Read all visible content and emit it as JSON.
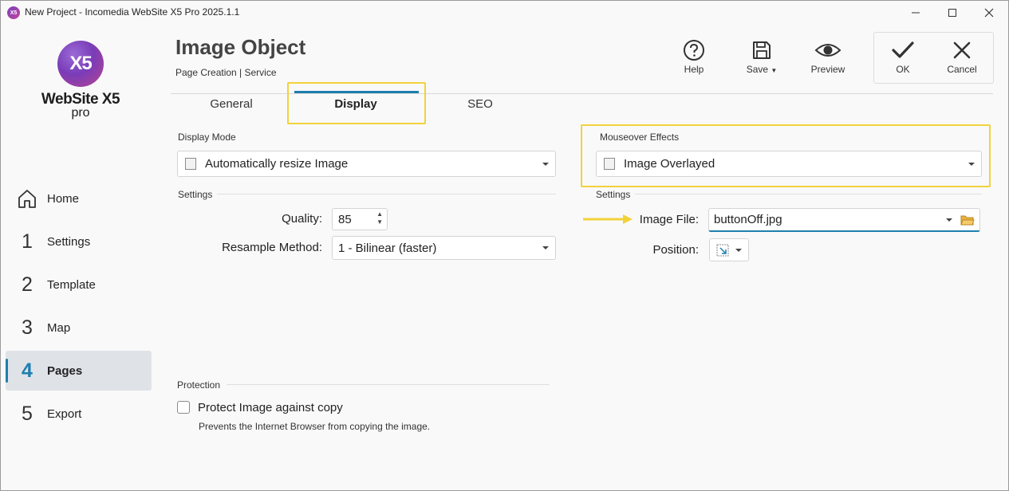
{
  "window": {
    "app_icon": "X5",
    "title": "New Project - Incomedia WebSite X5 Pro 2025.1.1",
    "controls": [
      "minimize-icon",
      "maximize-icon",
      "close-icon"
    ]
  },
  "logo": {
    "badge": "X5",
    "name": "WebSite X5",
    "edition": "pro"
  },
  "sidebar": {
    "items": [
      {
        "num": "",
        "label": "Home",
        "icon": "home-icon"
      },
      {
        "num": "1",
        "label": "Settings"
      },
      {
        "num": "2",
        "label": "Template"
      },
      {
        "num": "3",
        "label": "Map"
      },
      {
        "num": "4",
        "label": "Pages",
        "active": true
      },
      {
        "num": "5",
        "label": "Export"
      }
    ]
  },
  "header": {
    "title": "Image Object",
    "breadcrumb": "Page Creation | Service",
    "toolbar": {
      "help": "Help",
      "save": "Save",
      "preview": "Preview",
      "ok": "OK",
      "cancel": "Cancel"
    }
  },
  "tabs": [
    {
      "label": "General"
    },
    {
      "label": "Display",
      "active": true
    },
    {
      "label": "SEO"
    }
  ],
  "display_mode": {
    "group_label": "Display Mode",
    "selected": "Automatically resize Image"
  },
  "settings_left": {
    "group_label": "Settings",
    "quality_label": "Quality:",
    "quality_value": "85",
    "resample_label": "Resample Method:",
    "resample_value": "1 - Bilinear (faster)"
  },
  "mouseover": {
    "group_label": "Mouseover Effects",
    "selected": "Image Overlayed"
  },
  "settings_right": {
    "group_label": "Settings",
    "image_file_label": "Image File:",
    "image_file_value": "buttonOff.jpg",
    "position_label": "Position:"
  },
  "protection": {
    "group_label": "Protection",
    "checkbox_label": "Protect Image against copy",
    "checked": false,
    "description": "Prevents the Internet Browser from copying the image."
  },
  "colors": {
    "accent": "#1f7fae",
    "highlight": "#f2d23b",
    "arrow": "#f2d23b"
  }
}
